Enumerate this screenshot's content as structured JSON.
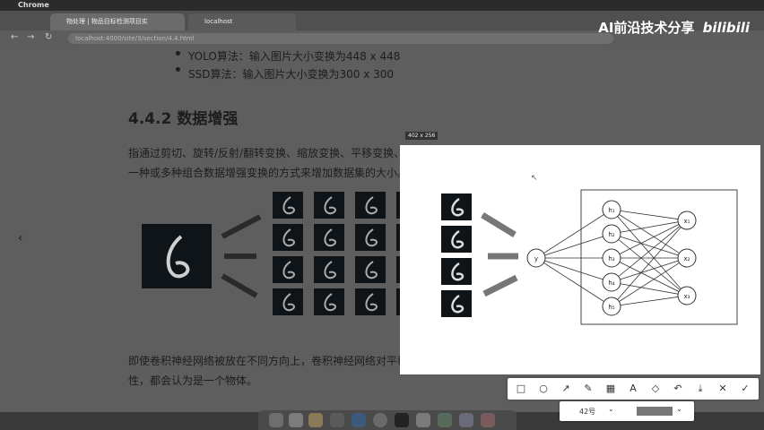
{
  "menubar": {
    "app": "Chrome"
  },
  "tabs": [
    {
      "label": "物处理 | 物品目标检测项目实"
    },
    {
      "label": "localhost"
    }
  ],
  "url": "localhost:4000/site/3/section/4.4.html",
  "brand": {
    "text": "AI前沿技术分享",
    "logo": "bilibili"
  },
  "doc": {
    "bullet1": "YOLO算法：输入图片大小变换为448 x 448",
    "bullet2": "SSD算法：输入图片大小变换为300 x 300",
    "heading": "4.4.2 数据增强",
    "para1": "指通过剪切、旋转/反射/翻转变换、缩放变换、平移变换、尺度变换、对比度变换、噪声扰动、颜色变换等",
    "para2": "一种或多种组合数据增强变换的方式来增加数据集的大小。",
    "para3": "即使卷积神经网络被放在不同方向上，卷积神经网络对平移、视角、尺寸或照度（或以上组合）保持不变",
    "para4": "性，都会认为是一个物体。"
  },
  "selection": {
    "size_label": "402 x 256"
  },
  "network": {
    "input": "y",
    "hidden": [
      "h₁",
      "h₂",
      "h₃",
      "h₄",
      "h₅"
    ],
    "outputs": [
      "x₁",
      "x₂",
      "x₃"
    ]
  },
  "toolbar": {
    "icons": [
      "rectangle-icon",
      "ellipse-icon",
      "arrow-icon",
      "pen-icon",
      "mosaic-icon",
      "text-icon",
      "marker-icon",
      "undo-icon",
      "save-icon",
      "close-icon",
      "confirm-icon"
    ],
    "glyphs": [
      "□",
      "○",
      "↗",
      "✎",
      "▦",
      "A",
      "◇",
      "↶",
      "⤓",
      "✕",
      "✓"
    ]
  },
  "subbar": {
    "font_size": "42号"
  },
  "colors": {
    "dim": "#5e5e5e",
    "selection_bg": "#ffffff"
  }
}
